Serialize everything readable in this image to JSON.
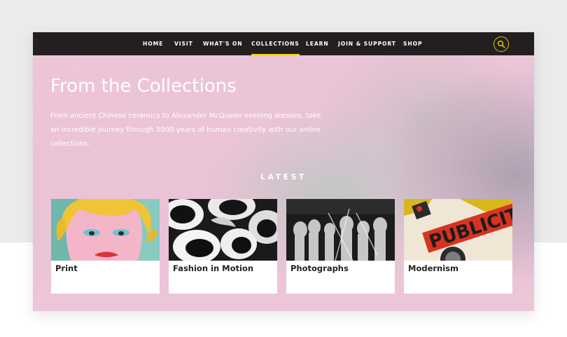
{
  "nav": {
    "items": [
      {
        "label": "HOME",
        "active": false
      },
      {
        "label": "VISIT",
        "active": false
      },
      {
        "label": "WHAT'S ON",
        "active": false
      },
      {
        "label": "COLLECTIONS",
        "active": true
      },
      {
        "label": "LEARN",
        "active": false
      },
      {
        "label": "JOIN & SUPPORT",
        "active": false
      },
      {
        "label": "SHOP",
        "active": false
      }
    ],
    "search_icon": "search-icon",
    "accent_color": "#f2d600"
  },
  "hero": {
    "title": "From the Collections",
    "description": "From ancient Chinese ceramics to Alexander McQueen evening dresses, take an incredible journey through 5000 years of human creativity with our online collections."
  },
  "latest": {
    "heading": "LATEST",
    "cards": [
      {
        "label": "Print"
      },
      {
        "label": "Fashion in Motion"
      },
      {
        "label": "Photographs"
      },
      {
        "label": "Modernism"
      }
    ]
  },
  "colors": {
    "navbar": "#231f20",
    "hero_pink": "#ecc4d7",
    "hero_grey": "#bec6c4"
  }
}
